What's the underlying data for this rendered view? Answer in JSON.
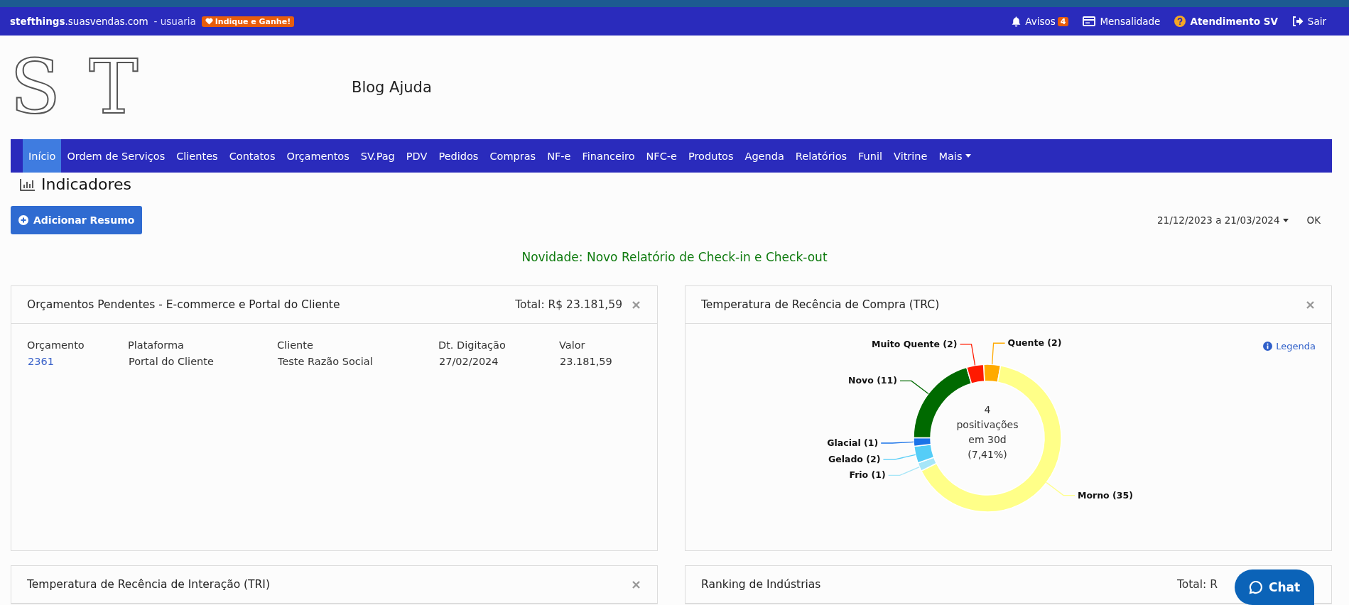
{
  "topbar": {
    "brand_bold": "stefthings",
    "brand_domain": ".suasvendas.com",
    "user": "- usuaria",
    "referral_badge": "Indique e Ganhe!",
    "links": [
      {
        "kind": "alerts",
        "label": "Avisos",
        "badge": "4"
      },
      {
        "kind": "billing",
        "label": "Mensalidade"
      },
      {
        "kind": "support",
        "label": "Atendimento SV"
      },
      {
        "kind": "logout",
        "label": "Sair"
      }
    ]
  },
  "logo": {
    "letters": [
      "S",
      "T"
    ]
  },
  "blog_link": "Blog Ajuda",
  "nav": [
    {
      "label": "Início",
      "selected": true
    },
    {
      "label": "Ordem de Serviços",
      "selected": false
    },
    {
      "label": "Clientes",
      "selected": false
    },
    {
      "label": "Contatos",
      "selected": false
    },
    {
      "label": "Orçamentos",
      "selected": false
    },
    {
      "label": "SV.Pag",
      "selected": false
    },
    {
      "label": "PDV",
      "selected": false
    },
    {
      "label": "Pedidos",
      "selected": false
    },
    {
      "label": "Compras",
      "selected": false
    },
    {
      "label": "NF-e",
      "selected": false
    },
    {
      "label": "Financeiro",
      "selected": false
    },
    {
      "label": "NFC-e",
      "selected": false
    },
    {
      "label": "Produtos",
      "selected": false
    },
    {
      "label": "Agenda",
      "selected": false
    },
    {
      "label": "Relatórios",
      "selected": false
    },
    {
      "label": "Funil",
      "selected": false
    },
    {
      "label": "Vitrine",
      "selected": false
    },
    {
      "label": "Mais",
      "selected": false,
      "dropdown": true
    }
  ],
  "page_title": "Indicadores",
  "add_button": "Adicionar Resumo",
  "date_range": "21/12/2023 a 21/03/2024",
  "ok_button": "OK",
  "news": "Novidade: Novo Relatório de Check-in e Check-out",
  "cards": [
    {
      "kind": "table",
      "title": "Orçamentos Pendentes - E-commerce e Portal do Cliente",
      "total": "Total: R$ 23.181,59",
      "closable": true,
      "columns": [
        "Orçamento",
        "Plataforma",
        "Cliente",
        "Dt. Digitação",
        "Valor"
      ],
      "rows": [
        [
          "2361",
          "Portal do Cliente",
          "Teste Razão Social",
          "27/02/2024",
          "23.181,59"
        ]
      ]
    },
    {
      "kind": "donut",
      "title": "Temperatura de Recência de Compra (TRC)",
      "closable": true,
      "legend_link": "Legenda",
      "center": [
        "4",
        "positivações",
        "em 30d",
        "(7,41%)"
      ],
      "chart_data": {
        "type": "donut",
        "categories": [
          "Quente (2)",
          "Morno (35)",
          "Frio (1)",
          "Gelado (2)",
          "Glacial (1)",
          "Novo (11)",
          "Muito Quente (2)"
        ],
        "series": [
          {
            "values": [
              2,
              35,
              1,
              2,
              1,
              11,
              2
            ],
            "colors": [
              "#ffaa00",
              "#ffff88",
              "#a6e6f8",
              "#55cdf7",
              "#1a73e8",
              "#006a00",
              "#ff1a00"
            ]
          }
        ]
      }
    },
    {
      "kind": "plain",
      "title": "Temperatura de Recência de Interação (TRI)",
      "closable": true
    },
    {
      "kind": "plain",
      "title": "Ranking de Indústrias",
      "total": "Total: R",
      "closable": false
    }
  ],
  "chat_button": "Chat"
}
